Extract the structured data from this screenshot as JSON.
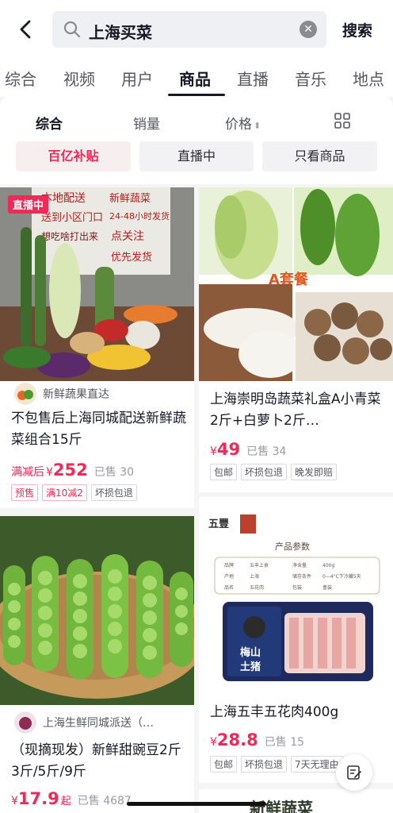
{
  "header": {
    "query": "上海买菜",
    "search_label": "搜索"
  },
  "tabs": [
    "综合",
    "视频",
    "用户",
    "商品",
    "直播",
    "音乐",
    "地点"
  ],
  "active_tab": 3,
  "sort": [
    "综合",
    "销量",
    "价格"
  ],
  "chips": [
    "百亿补贴",
    "直播中",
    "只看商品"
  ],
  "products": [
    {
      "live": "直播中",
      "image_text": [
        "本地配送",
        "送到小区门口",
        "想吃啥打出来",
        "新鲜蔬菜",
        "24-48小时发货",
        "点关注",
        "优先发货"
      ],
      "shop": "新鲜蔬果直达",
      "title": "不包售后上海同城配送新鲜蔬菜组合15斤",
      "prefix": "满减后",
      "yen": "¥",
      "price": "252",
      "sold": "已售 30",
      "tags": [
        "预售",
        "满10减2",
        "坏损包退"
      ]
    },
    {
      "image_text": "A套餐",
      "title": "上海崇明岛蔬菜礼盒A小青菜2斤+白萝卜2斤…",
      "yen": "¥",
      "price": "49",
      "sold": "已售 34",
      "tags": [
        "包邮",
        "坏损包退",
        "晚发即赔"
      ]
    },
    {
      "shop": "上海生鲜同城派送（…",
      "title": "（现摘现发）新鲜甜豌豆2斤3斤/5斤/9斤",
      "yen": "¥",
      "price": "17.9",
      "qi": "起",
      "sold": "已售 4687"
    },
    {
      "brand": "五豐",
      "params_title": "产品参数",
      "params": [
        "品牌",
        "五丰上食",
        "净含量",
        "400g",
        "产地",
        "上海",
        "储存条件",
        "0—4°C下冷藏5天",
        "品名",
        "五花肉",
        "包装",
        "盒装"
      ],
      "package_text": [
        "梅山",
        "土猪"
      ],
      "title": "上海五丰五花肉400g",
      "yen": "¥",
      "price": "28.8",
      "sold": "已售 15",
      "tags": [
        "包邮",
        "坏损包退",
        "7天无理由"
      ]
    }
  ],
  "next_card_text": "新鲜蔬菜"
}
